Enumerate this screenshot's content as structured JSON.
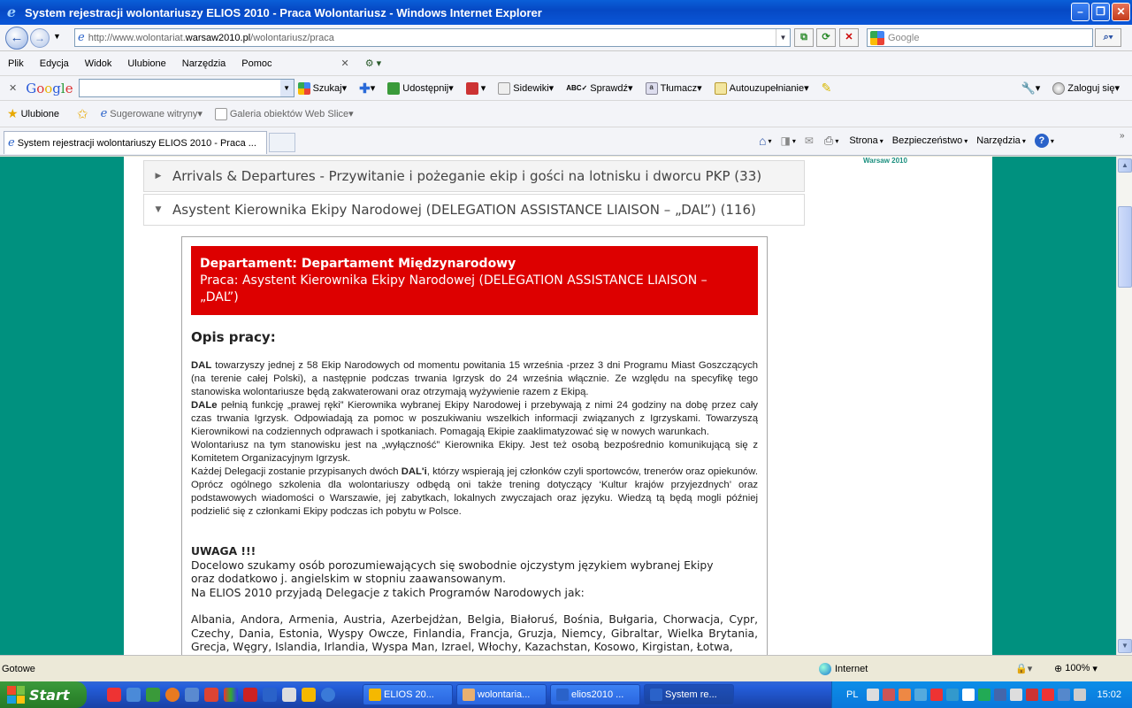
{
  "window": {
    "title": "System rejestracji wolontariuszy ELIOS 2010 - Praca Wolontariusz - Windows Internet Explorer"
  },
  "address": {
    "prefix": "http://www.wolontariat.",
    "domain": "warsaw2010.pl",
    "path": "/wolontariusz/praca",
    "search_placeholder": "Google"
  },
  "menu": [
    "Plik",
    "Edycja",
    "Widok",
    "Ulubione",
    "Narzędzia",
    "Pomoc"
  ],
  "google_toolbar": {
    "logo": "Google",
    "items": [
      "Szukaj",
      "Udostępnij",
      "Sidewiki",
      "Sprawdź",
      "Tłumacz",
      "Autouzupełnianie"
    ],
    "signin": "Zaloguj się"
  },
  "favorites": {
    "label": "Ulubione",
    "items": [
      "Sugerowane witryny",
      "Galeria obiektów Web Slice"
    ]
  },
  "tab": {
    "title": "System rejestracji wolontariuszy ELIOS 2010 - Praca ..."
  },
  "command_bar": [
    "Strona",
    "Bezpieczeństwo",
    "Narzędzia"
  ],
  "page": {
    "logo_text": "Warsaw 2010",
    "accordion": [
      {
        "title": "Arrivals & Departures - Przywitanie i pożeganie ekip i gości na lotnisku i dworcu PKP (33)",
        "expanded": false
      },
      {
        "title": "Asystent Kierownika Ekipy Narodowej (DELEGATION ASSISTANCE LIAISON – „DAL”) (116)",
        "expanded": true
      }
    ],
    "department_line": "Departament: Departament Międzynarodowy",
    "job_line": "Praca: Asystent Kierownika Ekipy Narodowej (DELEGATION ASSISTANCE LIAISON – „DAL”)",
    "heading": "Opis pracy:",
    "p1_bold": "DAL",
    "p1": " towarzyszy jednej z 58 Ekip Narodowych od momentu powitania 15 września -przez 3 dni Programu Miast Goszczących (na terenie całej Polski), a następnie podczas trwania Igrzysk do  24 września włącznie. Ze względu na specyfikę tego stanowiska wolontariusze będą zakwaterowani oraz otrzymają wyżywienie razem z Ekipą.",
    "p2_bold": "DALe",
    "p2": " pełnią funkcję „prawej ręki” Kierownika wybranej Ekipy Narodowej i przebywają z nimi 24 godziny na dobę przez cały czas trwania Igrzysk. Odpowiadają za pomoc w poszukiwaniu wszelkich informacji związanych z Igrzyskami. Towarzyszą Kierownikowi na codziennych odprawach i spotkaniach. Pomagają Ekipie zaaklimatyzować się w nowych warunkach.",
    "p3": "Wolontariusz na tym stanowisku jest na „wyłączność” Kierownika Ekipy. Jest też osobą bezpośrednio komunikującą się z Komitetem Organizacyjnym Igrzysk.",
    "p4_a": "Każdej Delegacji zostanie przypisanych dwóch ",
    "p4_bold": "DAL'i",
    "p4_b": ", którzy wspierają jej członków czyli sportowców, trenerów oraz opiekunów.  Oprócz ogólnego szkolenia dla wolontariuszy odbędą oni także trening dotyczący ‘Kultur krajów przyjezdnych’ oraz podstawowych wiadomości o Warszawie, jej zabytkach, lokalnych zwyczajach oraz języku. Wiedzą tą będą mogli później podzielić się z członkami Ekipy podczas ich pobytu w Polsce.",
    "uwaga": "UWAGA !!!",
    "u1": "Docelowo szukamy osób porozumiewających się swobodnie ojczystym językiem wybranej Ekipy",
    "u2": "oraz  dodatkowo j. angielskim w stopniu zaawansowanym.",
    "u3": "Na ELIOS 2010 przyjadą Delegacje z takich Programów Narodowych jak:",
    "countries": "Albania, Andora, Armenia, Austria, Azerbejdżan, Belgia, Białoruś, Bośnia, Bułgaria, Chorwacja, Cypr, Czechy, Dania, Estonia, Wyspy Owcze, Finlandia, Francja, Gruzja, Niemcy, Gibraltar, Wielka Brytania, Grecja, Węgry, Islandia, Irlandia, Wyspa Man, Izrael, Włochy, Kazachstan, Kosowo, Kirgistan, Łotwa,"
  },
  "status": {
    "left": "Gotowe",
    "zone": "Internet",
    "zoom": "100%"
  },
  "taskbar": {
    "start": "Start",
    "tasks": [
      "ELIOS 20...",
      "wolontaria...",
      "elios2010 ...",
      "System re..."
    ],
    "lang": "PL",
    "time": "15:02"
  }
}
